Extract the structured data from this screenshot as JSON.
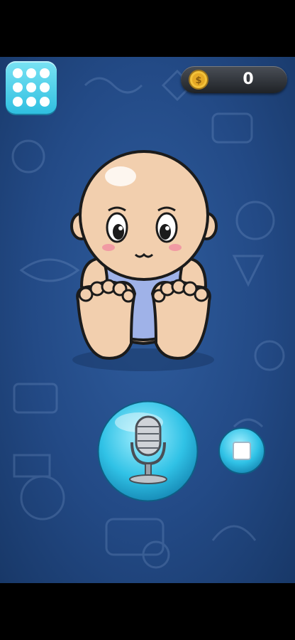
{
  "top_bar": {
    "coin_count": "0",
    "coin_icon": "coin-icon",
    "menu_icon": "grid-menu-icon"
  },
  "character": {
    "name_icon": "baby-character"
  },
  "controls": {
    "record_icon": "microphone-icon",
    "stop_icon": "stop-icon"
  },
  "colors": {
    "background": "#234a86",
    "accent_button": "#33c2e4",
    "coin_gold": "#f0b82a"
  }
}
